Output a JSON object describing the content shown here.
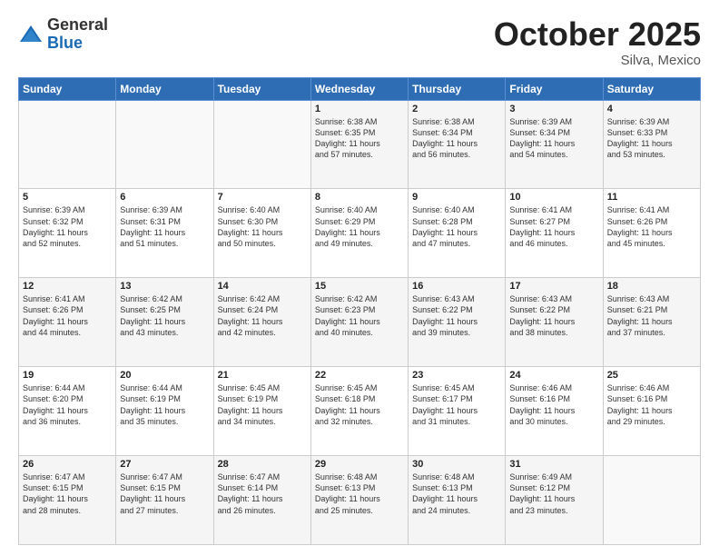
{
  "header": {
    "logo": {
      "general": "General",
      "blue": "Blue"
    },
    "title": "October 2025",
    "location": "Silva, Mexico"
  },
  "days_of_week": [
    "Sunday",
    "Monday",
    "Tuesday",
    "Wednesday",
    "Thursday",
    "Friday",
    "Saturday"
  ],
  "weeks": [
    [
      {
        "day": "",
        "info": ""
      },
      {
        "day": "",
        "info": ""
      },
      {
        "day": "",
        "info": ""
      },
      {
        "day": "1",
        "info": "Sunrise: 6:38 AM\nSunset: 6:35 PM\nDaylight: 11 hours\nand 57 minutes."
      },
      {
        "day": "2",
        "info": "Sunrise: 6:38 AM\nSunset: 6:34 PM\nDaylight: 11 hours\nand 56 minutes."
      },
      {
        "day": "3",
        "info": "Sunrise: 6:39 AM\nSunset: 6:34 PM\nDaylight: 11 hours\nand 54 minutes."
      },
      {
        "day": "4",
        "info": "Sunrise: 6:39 AM\nSunset: 6:33 PM\nDaylight: 11 hours\nand 53 minutes."
      }
    ],
    [
      {
        "day": "5",
        "info": "Sunrise: 6:39 AM\nSunset: 6:32 PM\nDaylight: 11 hours\nand 52 minutes."
      },
      {
        "day": "6",
        "info": "Sunrise: 6:39 AM\nSunset: 6:31 PM\nDaylight: 11 hours\nand 51 minutes."
      },
      {
        "day": "7",
        "info": "Sunrise: 6:40 AM\nSunset: 6:30 PM\nDaylight: 11 hours\nand 50 minutes."
      },
      {
        "day": "8",
        "info": "Sunrise: 6:40 AM\nSunset: 6:29 PM\nDaylight: 11 hours\nand 49 minutes."
      },
      {
        "day": "9",
        "info": "Sunrise: 6:40 AM\nSunset: 6:28 PM\nDaylight: 11 hours\nand 47 minutes."
      },
      {
        "day": "10",
        "info": "Sunrise: 6:41 AM\nSunset: 6:27 PM\nDaylight: 11 hours\nand 46 minutes."
      },
      {
        "day": "11",
        "info": "Sunrise: 6:41 AM\nSunset: 6:26 PM\nDaylight: 11 hours\nand 45 minutes."
      }
    ],
    [
      {
        "day": "12",
        "info": "Sunrise: 6:41 AM\nSunset: 6:26 PM\nDaylight: 11 hours\nand 44 minutes."
      },
      {
        "day": "13",
        "info": "Sunrise: 6:42 AM\nSunset: 6:25 PM\nDaylight: 11 hours\nand 43 minutes."
      },
      {
        "day": "14",
        "info": "Sunrise: 6:42 AM\nSunset: 6:24 PM\nDaylight: 11 hours\nand 42 minutes."
      },
      {
        "day": "15",
        "info": "Sunrise: 6:42 AM\nSunset: 6:23 PM\nDaylight: 11 hours\nand 40 minutes."
      },
      {
        "day": "16",
        "info": "Sunrise: 6:43 AM\nSunset: 6:22 PM\nDaylight: 11 hours\nand 39 minutes."
      },
      {
        "day": "17",
        "info": "Sunrise: 6:43 AM\nSunset: 6:22 PM\nDaylight: 11 hours\nand 38 minutes."
      },
      {
        "day": "18",
        "info": "Sunrise: 6:43 AM\nSunset: 6:21 PM\nDaylight: 11 hours\nand 37 minutes."
      }
    ],
    [
      {
        "day": "19",
        "info": "Sunrise: 6:44 AM\nSunset: 6:20 PM\nDaylight: 11 hours\nand 36 minutes."
      },
      {
        "day": "20",
        "info": "Sunrise: 6:44 AM\nSunset: 6:19 PM\nDaylight: 11 hours\nand 35 minutes."
      },
      {
        "day": "21",
        "info": "Sunrise: 6:45 AM\nSunset: 6:19 PM\nDaylight: 11 hours\nand 34 minutes."
      },
      {
        "day": "22",
        "info": "Sunrise: 6:45 AM\nSunset: 6:18 PM\nDaylight: 11 hours\nand 32 minutes."
      },
      {
        "day": "23",
        "info": "Sunrise: 6:45 AM\nSunset: 6:17 PM\nDaylight: 11 hours\nand 31 minutes."
      },
      {
        "day": "24",
        "info": "Sunrise: 6:46 AM\nSunset: 6:16 PM\nDaylight: 11 hours\nand 30 minutes."
      },
      {
        "day": "25",
        "info": "Sunrise: 6:46 AM\nSunset: 6:16 PM\nDaylight: 11 hours\nand 29 minutes."
      }
    ],
    [
      {
        "day": "26",
        "info": "Sunrise: 6:47 AM\nSunset: 6:15 PM\nDaylight: 11 hours\nand 28 minutes."
      },
      {
        "day": "27",
        "info": "Sunrise: 6:47 AM\nSunset: 6:15 PM\nDaylight: 11 hours\nand 27 minutes."
      },
      {
        "day": "28",
        "info": "Sunrise: 6:47 AM\nSunset: 6:14 PM\nDaylight: 11 hours\nand 26 minutes."
      },
      {
        "day": "29",
        "info": "Sunrise: 6:48 AM\nSunset: 6:13 PM\nDaylight: 11 hours\nand 25 minutes."
      },
      {
        "day": "30",
        "info": "Sunrise: 6:48 AM\nSunset: 6:13 PM\nDaylight: 11 hours\nand 24 minutes."
      },
      {
        "day": "31",
        "info": "Sunrise: 6:49 AM\nSunset: 6:12 PM\nDaylight: 11 hours\nand 23 minutes."
      },
      {
        "day": "",
        "info": ""
      }
    ]
  ]
}
